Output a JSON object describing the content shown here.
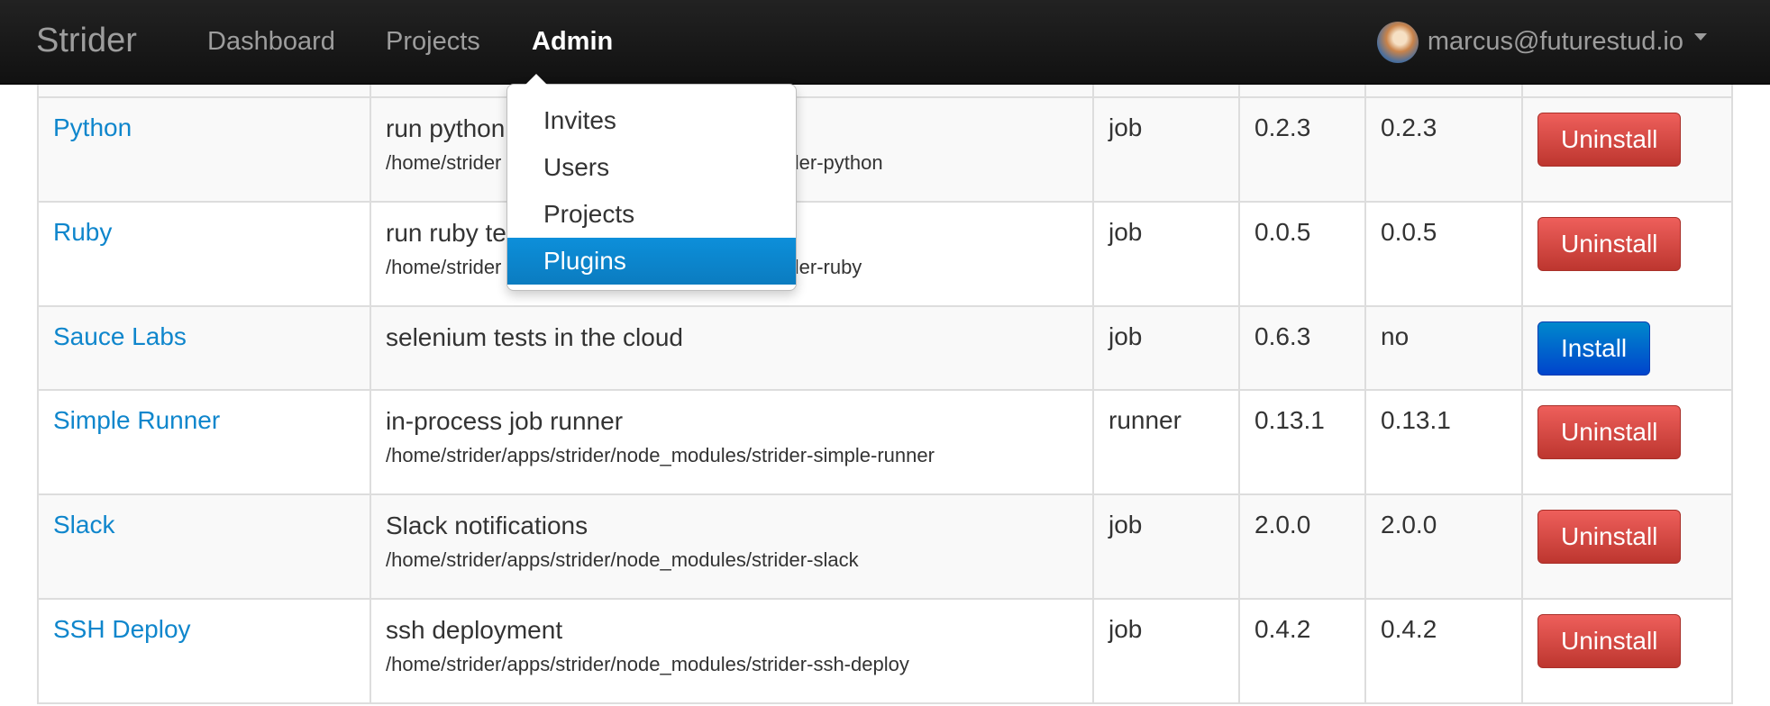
{
  "navbar": {
    "brand": "Strider",
    "links": [
      "Dashboard",
      "Projects",
      "Admin"
    ],
    "active": "Admin",
    "user_email": "marcus@futurestud.io"
  },
  "admin_menu": {
    "items": [
      "Invites",
      "Users",
      "Projects",
      "Plugins"
    ],
    "active": "Plugins"
  },
  "plugins": [
    {
      "name": "Python",
      "description": "run python",
      "path": "/home/strider",
      "path_end": "der-python",
      "type": "job",
      "latest": "0.2.3",
      "installed": "0.2.3",
      "action": "Uninstall"
    },
    {
      "name": "Ruby",
      "description": "run ruby te",
      "path": "/home/strider",
      "path_end": "der-ruby",
      "type": "job",
      "latest": "0.0.5",
      "installed": "0.0.5",
      "action": "Uninstall"
    },
    {
      "name": "Sauce Labs",
      "description": "selenium tests in the cloud",
      "path": "",
      "type": "job",
      "latest": "0.6.3",
      "installed": "no",
      "action": "Install"
    },
    {
      "name": "Simple Runner",
      "description": "in-process job runner",
      "path": "/home/strider/apps/strider/node_modules/strider-simple-runner",
      "type": "runner",
      "latest": "0.13.1",
      "installed": "0.13.1",
      "action": "Uninstall"
    },
    {
      "name": "Slack",
      "description": "Slack notifications",
      "path": "/home/strider/apps/strider/node_modules/strider-slack",
      "type": "job",
      "latest": "2.0.0",
      "installed": "2.0.0",
      "action": "Uninstall"
    },
    {
      "name": "SSH Deploy",
      "description": "ssh deployment",
      "path": "/home/strider/apps/strider/node_modules/strider-ssh-deploy",
      "type": "job",
      "latest": "0.4.2",
      "installed": "0.4.2",
      "action": "Uninstall"
    }
  ],
  "colors": {
    "link": "#0f86cc",
    "danger": "#da4f49",
    "primary": "#0074cc",
    "navbar": "#1b1b1b",
    "menu_active": "#0b82c9"
  }
}
